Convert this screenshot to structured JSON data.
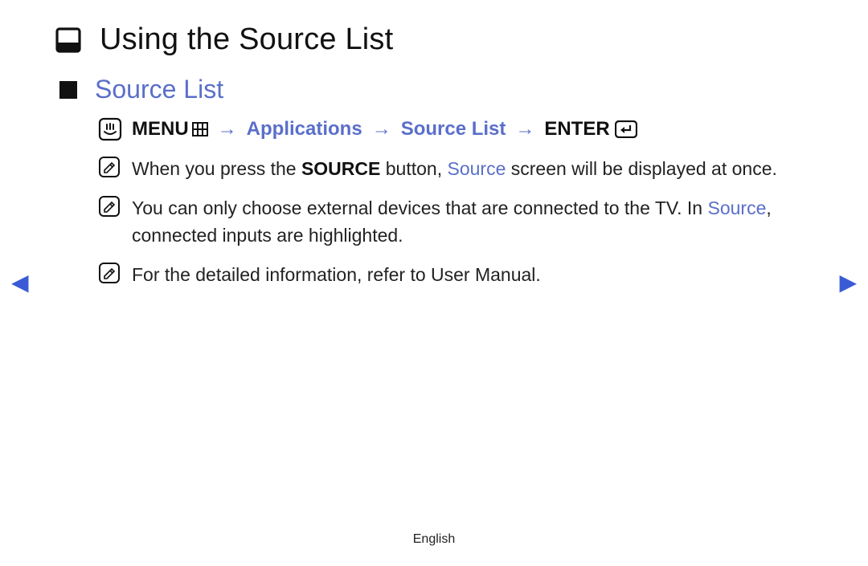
{
  "header": {
    "title": "Using the Source List"
  },
  "section": {
    "title": "Source List"
  },
  "path": {
    "menu": "MENU",
    "arrow": "→",
    "applications": "Applications",
    "sourceList": "Source List",
    "enter": "ENTER"
  },
  "notes": {
    "n1_pre": "When you press the ",
    "n1_bold": "SOURCE",
    "n1_mid": " button, ",
    "n1_blue": "Source",
    "n1_post": " screen will be displayed at once.",
    "n2_pre": "You can only choose external devices that are connected to the TV. In ",
    "n2_blue": "Source",
    "n2_post": ", connected inputs are highlighted.",
    "n3": "For the detailed information, refer to User Manual."
  },
  "footer": {
    "language": "English"
  }
}
